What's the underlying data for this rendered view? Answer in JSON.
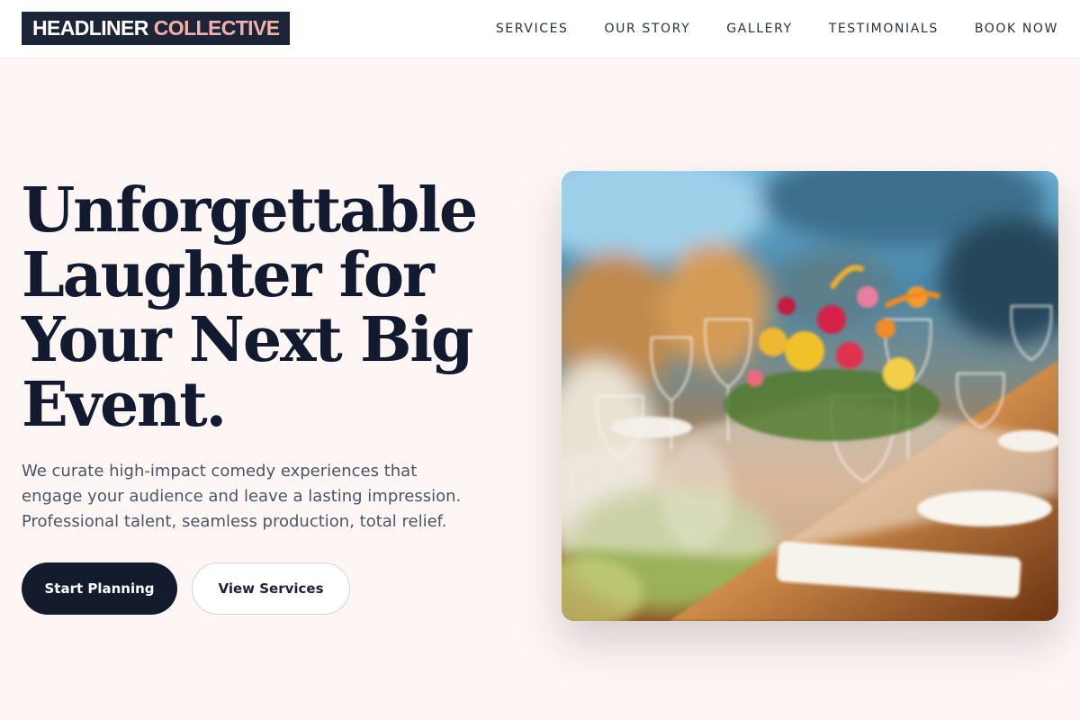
{
  "header": {
    "logo_primary": "HEADLINER",
    "logo_accent": "COLLECTIVE",
    "nav": [
      {
        "label": "SERVICES"
      },
      {
        "label": "OUR STORY"
      },
      {
        "label": "GALLERY"
      },
      {
        "label": "TESTIMONIALS"
      },
      {
        "label": "BOOK NOW"
      }
    ]
  },
  "hero": {
    "title_lines": [
      "Unforgettable",
      "Laughter for",
      "Your Next Big",
      "Event."
    ],
    "subtitle_lines": [
      "We curate high-impact comedy experiences that",
      "engage your audience and leave a lasting impression.",
      "Professional talent, seamless production, total relief."
    ],
    "primary_button": "Start Planning",
    "secondary_button": "View Services"
  },
  "colors": {
    "page_background": "#fdf6f5",
    "navy": "#141b2d",
    "logo_accent": "#f4b0aa",
    "body_text": "#4a5568"
  },
  "image": {
    "subject": "banquet-table-with-flowers-and-wine-glasses"
  }
}
